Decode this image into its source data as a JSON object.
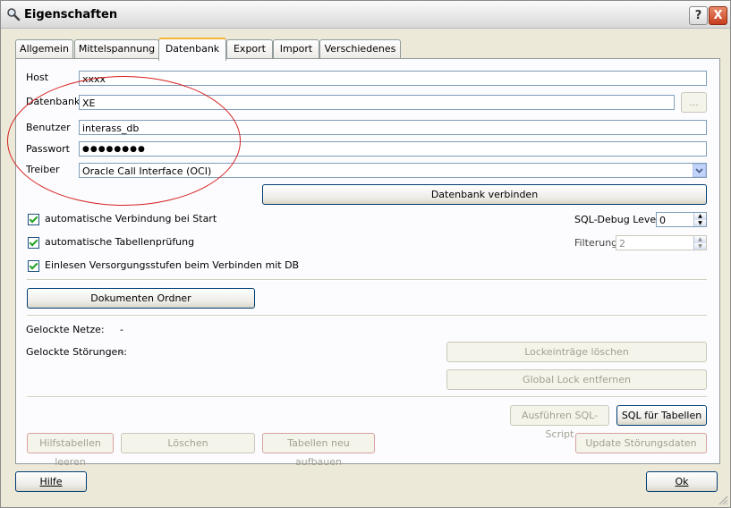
{
  "window": {
    "title": "Eigenschaften",
    "help_btn": "?",
    "close_btn": "X"
  },
  "tabs": [
    {
      "label": "Allgemein"
    },
    {
      "label": "Mittelspannung"
    },
    {
      "label": "Datenbank",
      "active": true
    },
    {
      "label": "Export"
    },
    {
      "label": "Import"
    },
    {
      "label": "Verschiedenes"
    }
  ],
  "db": {
    "host_label": "Host",
    "host_value": "xxxx",
    "datenbank_label": "Datenbank",
    "datenbank_value": "XE",
    "browse_label": "...",
    "benutzer_label": "Benutzer",
    "benutzer_value": "interass_db",
    "passwort_label": "Passwort",
    "passwort_value": "●●●●●●●●",
    "treiber_label": "Treiber",
    "treiber_value": "Oracle Call Interface (OCI)",
    "connect_button": "Datenbank verbinden"
  },
  "options": {
    "auto_connect": "automatische Verbindung bei Start",
    "auto_tablecheck": "automatische Tabellenprüfung",
    "read_supply": "Einlesen Versorgungsstufen beim Verbinden mit DB",
    "sql_debug_label": "SQL-Debug Level",
    "sql_debug_value": "0",
    "filtering_label": "Filterung",
    "filtering_value": "2"
  },
  "documents_button": "Dokumenten Ordner",
  "locks": {
    "nets_label": "Gelockte Netze:",
    "nets_value": "-",
    "faults_label": "Gelockte Störungen:",
    "faults_value": "-",
    "delete_entries": "Lockeinträge löschen",
    "remove_global": "Global Lock entfernen"
  },
  "sql": {
    "run_script": "Ausführen SQL-Script",
    "sql_tables": "SQL für Tabellen"
  },
  "maintenance": {
    "clear_helper": "Hilfstabellen leeren",
    "delete": "Löschen",
    "rebuild": "Tabellen neu aufbauen",
    "update_faults": "Update Störungsdaten"
  },
  "footer": {
    "help": "Hilfe",
    "ok": "Ok"
  },
  "colors": {
    "annotation": "#d62020",
    "tab_accent": "#f5b435",
    "close": "#c63c1d"
  }
}
